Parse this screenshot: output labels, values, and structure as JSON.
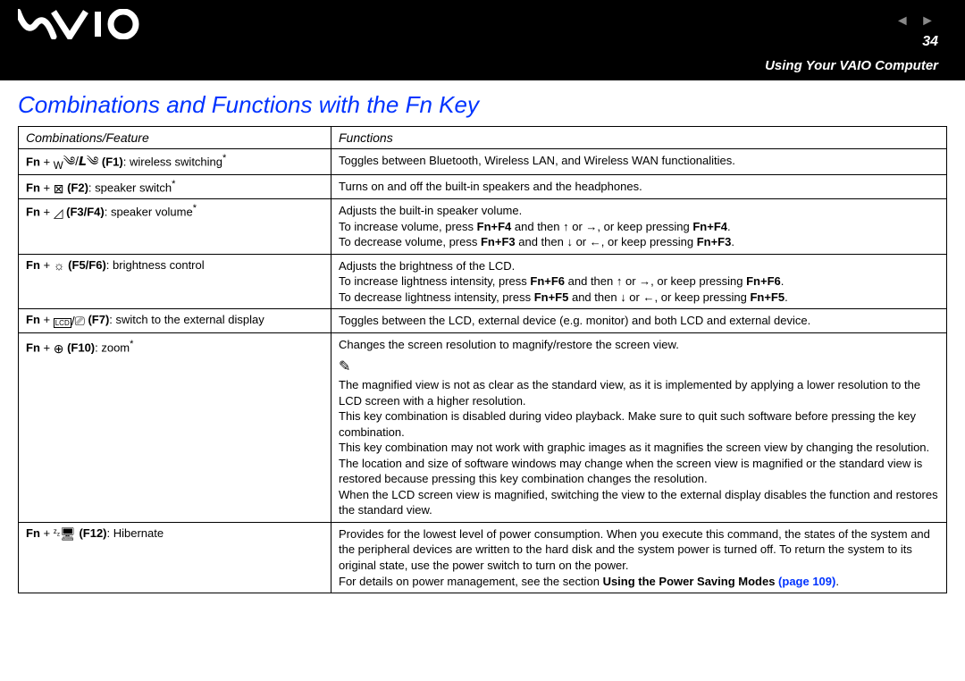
{
  "header": {
    "logo_text": "VAIO",
    "page_number": "34",
    "section": "Using Your VAIO Computer",
    "nav_prev": "◄",
    "nav_next": "►"
  },
  "title": "Combinations and Functions with the Fn Key",
  "table": {
    "headers": {
      "col1": "Combinations/Feature",
      "col2": "Functions"
    },
    "rows": {
      "r1": {
        "fn": "Fn",
        "plus": " + ",
        "key": " (F1)",
        "label": ": wireless switching",
        "ast": "*",
        "func_l1": "Toggles between Bluetooth, Wireless LAN, and Wireless WAN functionalities."
      },
      "r2": {
        "fn": "Fn",
        "plus": " + ",
        "key": " (F2)",
        "label": ": speaker switch",
        "ast": "*",
        "func_l1": "Turns on and off the built-in speakers and the headphones."
      },
      "r3": {
        "fn": "Fn",
        "plus": " + ",
        "key": " (F3/F4)",
        "label": ": speaker volume",
        "ast": "*",
        "func_l1": "Adjusts the built-in speaker volume.",
        "func_l2a": "To increase volume, press ",
        "func_l2b": "Fn+F4",
        "func_l2c": " and then ",
        "func_l2d": " or ",
        "func_l2e": ", or keep pressing ",
        "func_l2f": "Fn+F4",
        "func_l2g": ".",
        "func_l3a": "To decrease volume, press ",
        "func_l3b": "Fn+F3",
        "func_l3c": " and then ",
        "func_l3d": " or ",
        "func_l3e": ", or keep pressing ",
        "func_l3f": "Fn+F3",
        "func_l3g": "."
      },
      "r4": {
        "fn": "Fn",
        "plus": " + ",
        "key": " (F5/F6)",
        "label": ": brightness control",
        "func_l1": "Adjusts the brightness of the LCD.",
        "func_l2a": "To increase lightness intensity, press ",
        "func_l2b": "Fn+F6",
        "func_l2c": " and then ",
        "func_l2d": " or ",
        "func_l2e": ", or keep pressing ",
        "func_l2f": "Fn+F6",
        "func_l2g": ".",
        "func_l3a": "To decrease lightness intensity, press ",
        "func_l3b": "Fn+F5",
        "func_l3c": " and then ",
        "func_l3d": " or ",
        "func_l3e": ", or keep pressing ",
        "func_l3f": "Fn+F5",
        "func_l3g": "."
      },
      "r5": {
        "fn": "Fn",
        "plus": " + ",
        "key": " (F7)",
        "label": ": switch to the external display",
        "func_l1": "Toggles between the LCD, external device (e.g. monitor) and both LCD and external device."
      },
      "r6": {
        "fn": "Fn",
        "plus": " + ",
        "key": " (F10)",
        "label": ": zoom",
        "ast": "*",
        "func_l1": "Changes the screen resolution to magnify/restore the screen view.",
        "note1": "The magnified view is not as clear as the standard view, as it is implemented by applying a lower resolution to the LCD screen with a higher resolution.",
        "note2": "This key combination is disabled during video playback. Make sure to quit such software before pressing the key combination.",
        "note3": "This key combination may not work with graphic images as it magnifies the screen view by changing the resolution.",
        "note4": "The location and size of software windows may change when the screen view is magnified or the standard view is restored because pressing this key combination changes the resolution.",
        "note5": "When the LCD screen view is magnified, switching the view to the external display disables the function and restores the standard view."
      },
      "r7": {
        "fn": "Fn",
        "plus": " + ",
        "key": " (F12)",
        "label": ": Hibernate",
        "func_l1": "Provides for the lowest level of power consumption. When you execute this command, the states of the system and the peripheral devices are written to the hard disk and the system power is turned off. To return the system to its original state, use the power switch to turn on the power.",
        "func_l2a": "For details on power management, see the section ",
        "func_l2b": "Using the Power Saving Modes",
        "link_text": " (page 109)",
        "func_l2c": "."
      }
    }
  },
  "icons": {
    "wireless": "w📶/📡",
    "speaker": "🔇",
    "volume": "📐",
    "brightness": "☼",
    "display": "🖵/⎚",
    "zoom": "🔍",
    "hibernate": "⏻",
    "arrow_up": "↑",
    "arrow_right": "→",
    "arrow_down": "↓",
    "arrow_left": "←",
    "note": "✎"
  }
}
